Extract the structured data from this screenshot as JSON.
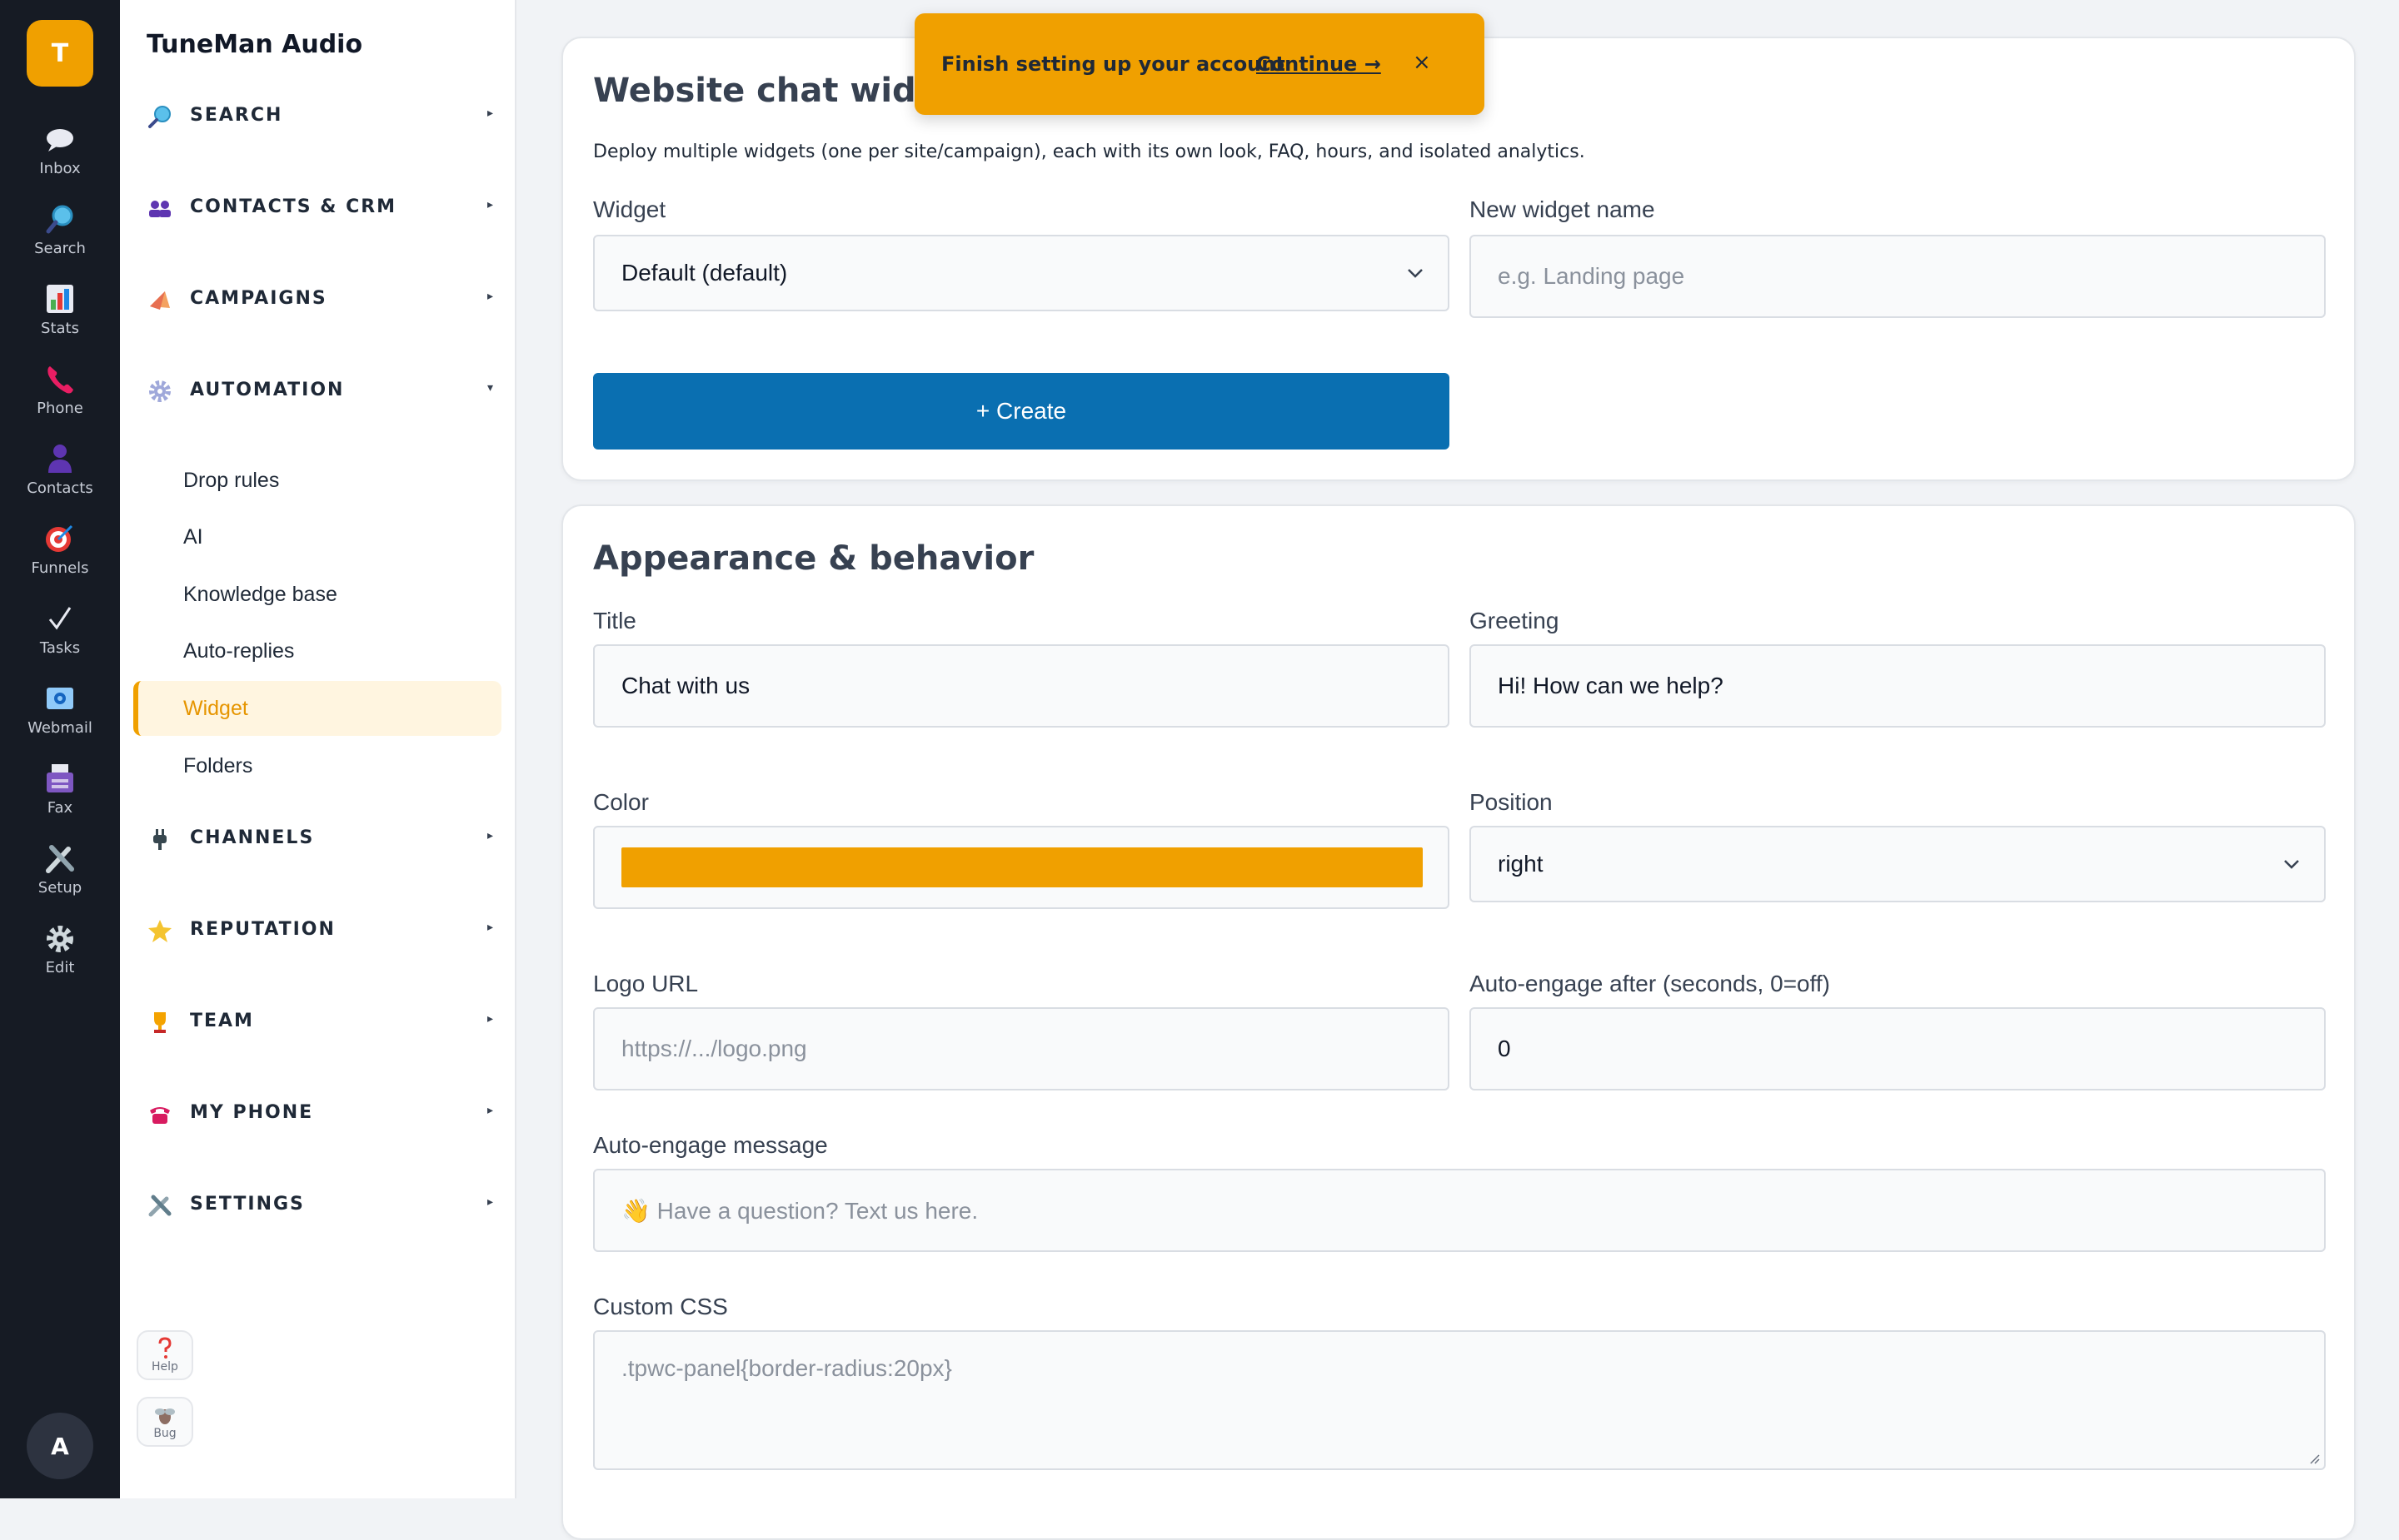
{
  "rail": {
    "logo": "T",
    "items": [
      {
        "label": "Inbox",
        "icon": "speech-bubble-icon"
      },
      {
        "label": "Search",
        "icon": "magnifier-icon"
      },
      {
        "label": "Stats",
        "icon": "bar-chart-icon"
      },
      {
        "label": "Phone",
        "icon": "phone-icon"
      },
      {
        "label": "Contacts",
        "icon": "person-icon"
      },
      {
        "label": "Funnels",
        "icon": "target-icon"
      },
      {
        "label": "Tasks",
        "icon": "checkmark-icon"
      },
      {
        "label": "Webmail",
        "icon": "mail-icon"
      },
      {
        "label": "Fax",
        "icon": "fax-icon"
      },
      {
        "label": "Setup",
        "icon": "tools-icon"
      },
      {
        "label": "Edit",
        "icon": "gear-icon"
      }
    ],
    "avatar": "A"
  },
  "sidebar": {
    "brand": "TuneMan Audio",
    "sections": [
      {
        "label": "SEARCH",
        "icon": "magnifier-icon",
        "caret": "▸"
      },
      {
        "label": "CONTACTS & CRM",
        "icon": "people-icon",
        "caret": "▸"
      },
      {
        "label": "CAMPAIGNS",
        "icon": "megaphone-icon",
        "caret": "▸"
      },
      {
        "label": "AUTOMATION",
        "icon": "gear-icon",
        "caret": "▾"
      },
      {
        "label": "CHANNELS",
        "icon": "plug-icon",
        "caret": "▸"
      },
      {
        "label": "REPUTATION",
        "icon": "star-icon",
        "caret": "▸"
      },
      {
        "label": "TEAM",
        "icon": "trophy-icon",
        "caret": "▸"
      },
      {
        "label": "MY PHONE",
        "icon": "telephone-icon",
        "caret": "▸"
      },
      {
        "label": "SETTINGS",
        "icon": "tools-icon",
        "caret": "▸"
      }
    ],
    "automation_items": [
      "Drop rules",
      "AI",
      "Knowledge base",
      "Auto-replies",
      "Widget",
      "Folders"
    ],
    "help_label": "Help",
    "bug_label": "Bug"
  },
  "toast": {
    "message": "Finish setting up your account",
    "link": "Continue →",
    "close": "×"
  },
  "widgets_card": {
    "title": "Website chat widgets",
    "description": "Deploy multiple widgets (one per site/campaign), each with its own look, FAQ, hours, and isolated analytics.",
    "widget_label": "Widget",
    "widget_value": "Default (default)",
    "new_name_label": "New widget name",
    "new_name_placeholder": "e.g. Landing page",
    "create_button": "+ Create"
  },
  "appearance_card": {
    "title": "Appearance & behavior",
    "title_label": "Title",
    "title_value": "Chat with us",
    "greeting_label": "Greeting",
    "greeting_value": "Hi! How can we help?",
    "color_label": "Color",
    "color_value": "#f0a000",
    "position_label": "Position",
    "position_value": "right",
    "logo_label": "Logo URL",
    "logo_placeholder": "https://.../logo.png",
    "autoengage_label": "Auto-engage after (seconds, 0=off)",
    "autoengage_value": "0",
    "autoengage_msg_label": "Auto-engage message",
    "autoengage_msg_placeholder": "👋 Have a question? Text us here.",
    "css_label": "Custom CSS",
    "css_value": ".tpwc-panel{border-radius:20px}"
  },
  "colors": {
    "accent": "#f0a000",
    "primary_button": "#0a6fb1",
    "rail_bg": "#161b24"
  }
}
